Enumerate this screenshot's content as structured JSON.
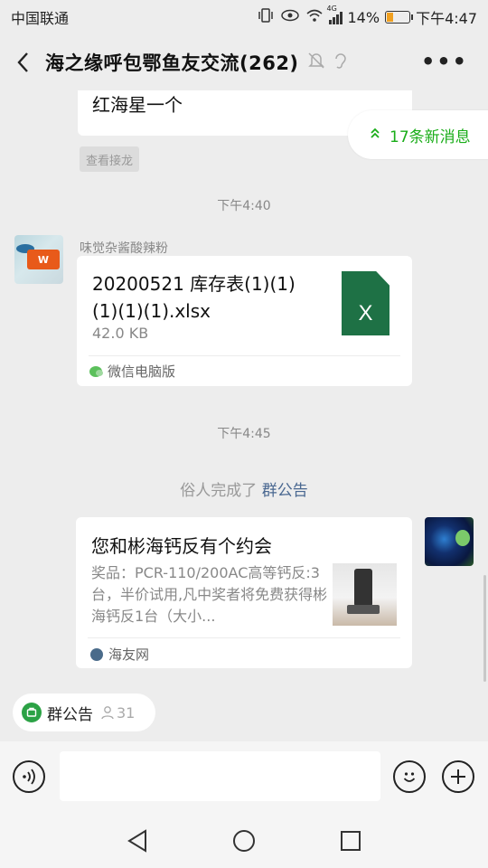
{
  "status_bar": {
    "carrier": "中国联通",
    "battery": "14%",
    "time": "下午4:47",
    "network": "4G"
  },
  "header": {
    "title": "海之缘呼包鄂鱼友交流(262)"
  },
  "messages": {
    "partial_text": "红海星一个",
    "relay_label": "查看接龙",
    "new_messages": "17条新消息",
    "time_1": "下午4:40",
    "sender_name": "味觉杂酱酸辣粉",
    "file": {
      "name": "20200521 库存表(1)(1)(1)(1)(1).xlsx",
      "size": "42.0 KB",
      "icon_letter": "X",
      "source": "微信电脑版"
    },
    "time_2": "下午4:45",
    "system": {
      "prefix": "俗人完成了",
      "link": "群公告"
    },
    "card": {
      "title": "您和彬海钙反有个约会",
      "desc": "奖品：PCR-110/200AC高等钙反:3台，半价试用,凡中奖者将免费获得彬海钙反1台（大小...",
      "source": "海友网"
    }
  },
  "notice_bar": {
    "label": "群公告",
    "count": "31"
  },
  "colors": {
    "accent_green": "#1aad19",
    "excel_green": "#1e7145",
    "link_blue": "#4a6891",
    "background": "#ededed"
  }
}
